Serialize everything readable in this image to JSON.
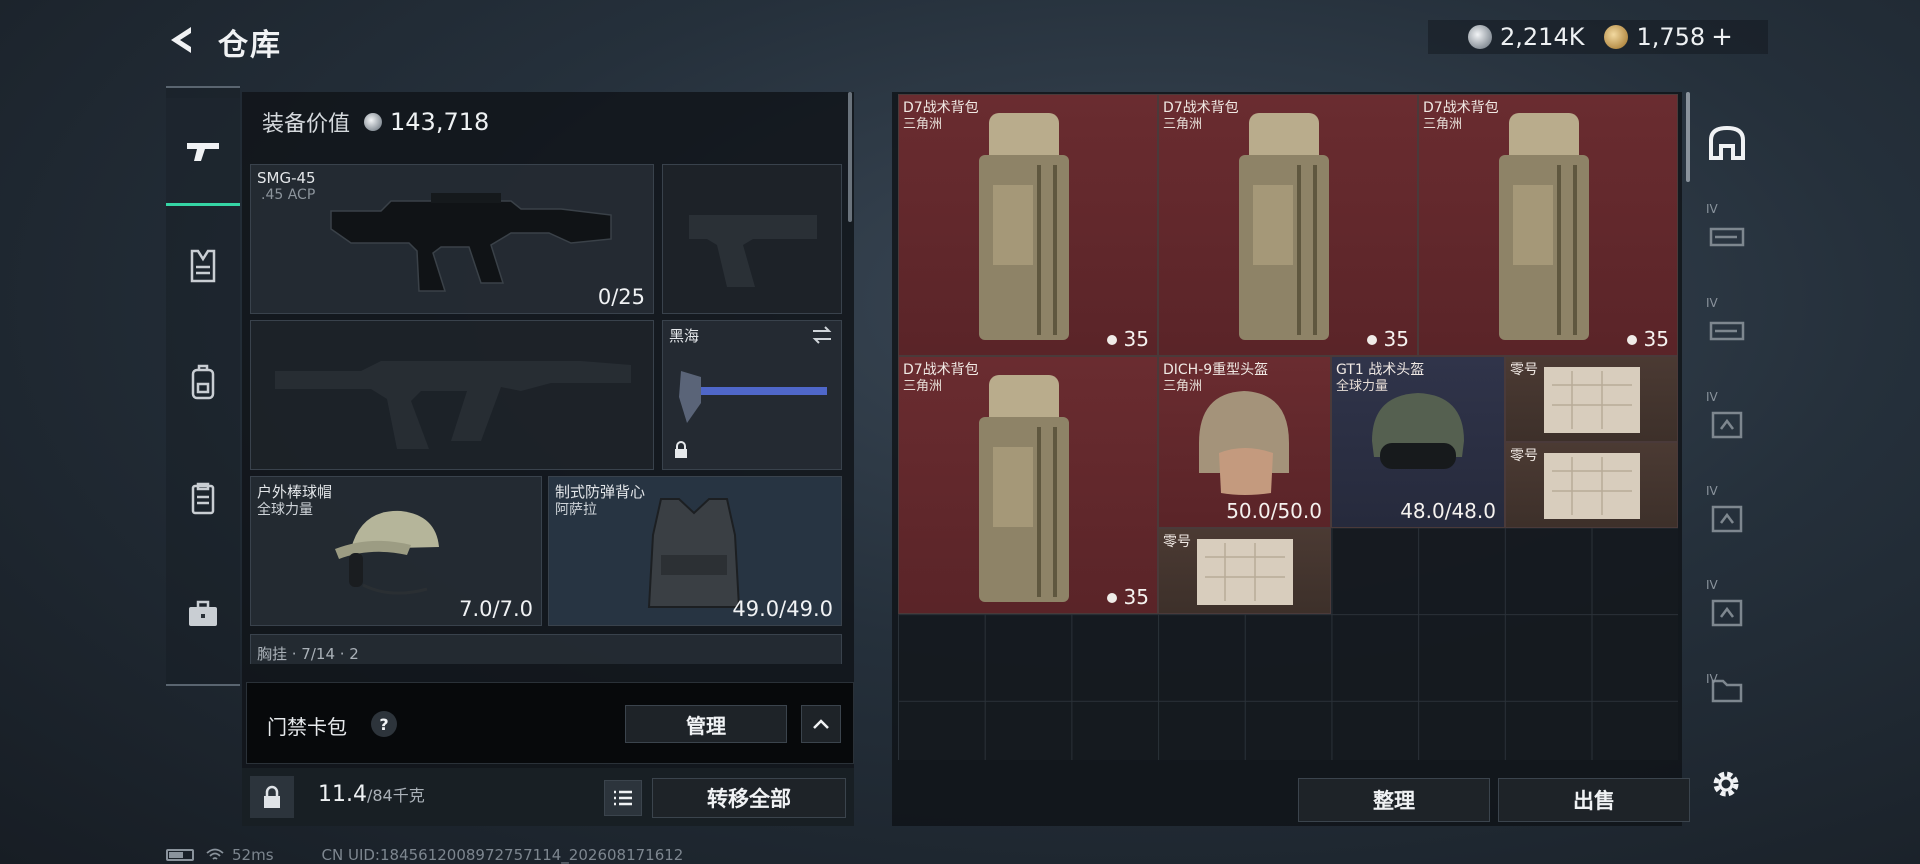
{
  "header": {
    "title": "仓库"
  },
  "currency": {
    "silver": "2,214K",
    "gold": "1,758",
    "add": "+"
  },
  "categories": [
    {
      "icon": "gun-icon"
    },
    {
      "icon": "vest-icon"
    },
    {
      "icon": "backpack-icon"
    },
    {
      "icon": "clipboard-icon"
    },
    {
      "icon": "briefcase-icon"
    }
  ],
  "equipment": {
    "value_label": "装备价值",
    "value": "143,718",
    "primary": {
      "name": "SMG-45",
      "ammo": ".45 ACP",
      "count": "0/25"
    },
    "melee": {
      "name": "黑海"
    },
    "helmet": {
      "name": "户外棒球帽",
      "faction": "全球力量",
      "durability": "7.0/7.0"
    },
    "armor": {
      "name": "制式防弹背心",
      "faction": "阿萨拉",
      "durability": "49.0/49.0"
    },
    "chest_partial": "胸挂 · 7/14 · 2"
  },
  "card_pack": {
    "label": "门禁卡包",
    "help": "?",
    "manage": "管理"
  },
  "weight": {
    "current": "11.4",
    "capacity": "/84千克",
    "transfer_all": "转移全部"
  },
  "storage": {
    "items": [
      {
        "name": "D7战术背包",
        "sub": "三角洲",
        "value": "35"
      },
      {
        "name": "D7战术背包",
        "sub": "三角洲",
        "value": "35"
      },
      {
        "name": "D7战术背包",
        "sub": "三角洲",
        "value": "35"
      },
      {
        "name": "D7战术背包",
        "sub": "三角洲",
        "value": "35"
      },
      {
        "name": "DICH-9重型头盔",
        "sub": "三角洲",
        "value": "50.0/50.0"
      },
      {
        "name": "GT1 战术头盔",
        "sub": "全球力量",
        "value": "48.0/48.0"
      },
      {
        "name": "零号",
        "sub": ""
      },
      {
        "name": "零号",
        "sub": ""
      },
      {
        "name": "零号",
        "sub": ""
      }
    ],
    "sort": "整理",
    "sell": "出售"
  },
  "rail": {
    "tier": "IV"
  },
  "status": {
    "ping": "52ms",
    "uid": "CN UID:1845612008972757114_202608171612"
  },
  "colors": {
    "accent": "#35d5a5",
    "red_item": "#6a2c30",
    "brown_item": "#4b3a33"
  }
}
